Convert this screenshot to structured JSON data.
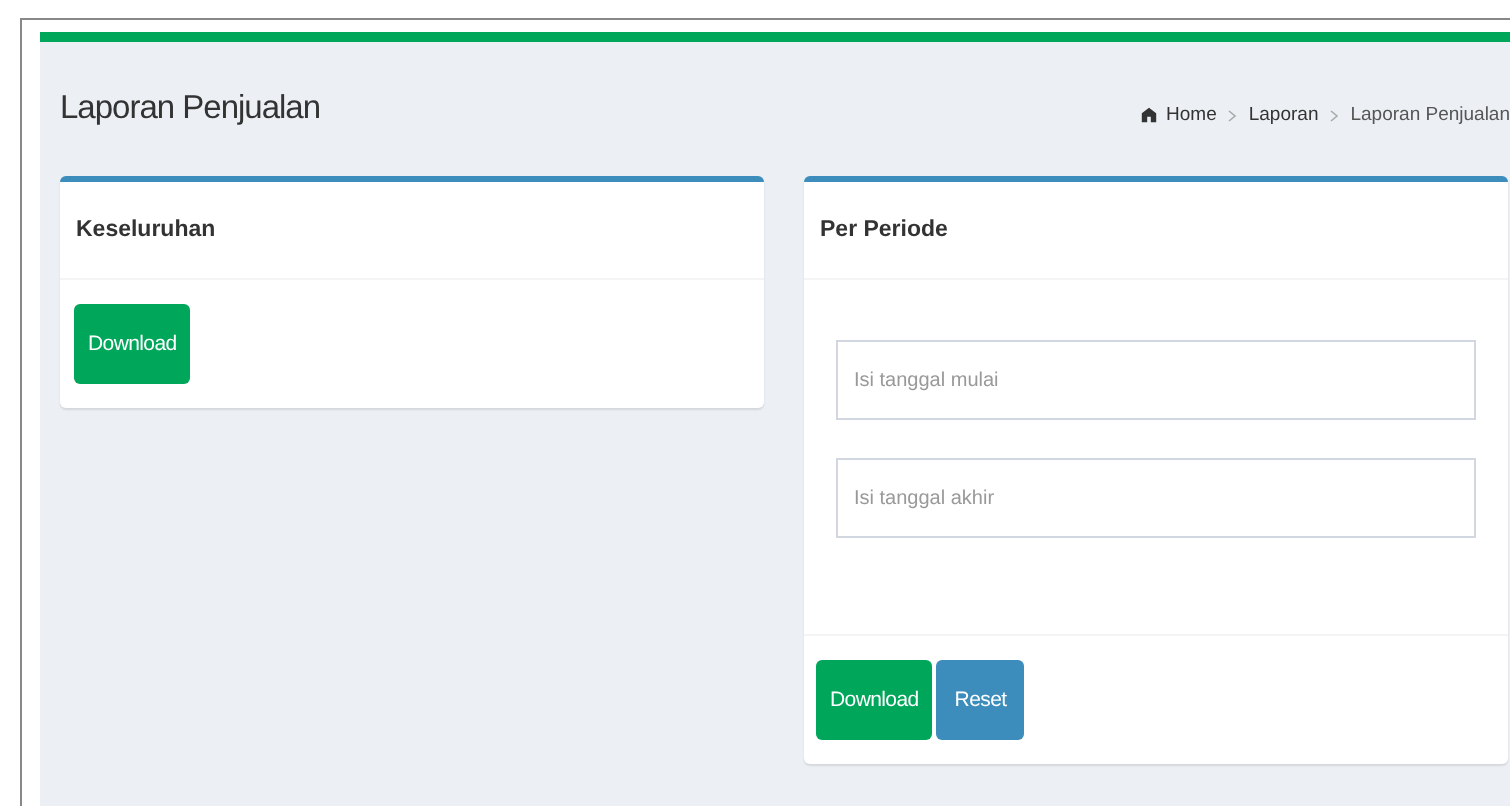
{
  "page": {
    "title": "Laporan Penjualan"
  },
  "breadcrumb": [
    {
      "label": "Home"
    },
    {
      "label": "Laporan"
    },
    {
      "label": "Laporan Penjualan"
    }
  ],
  "panels": [
    {
      "title": "Keseluruhan",
      "buttons": [
        {
          "label": "Download",
          "kind": "success"
        }
      ]
    },
    {
      "title": "Per Periode",
      "fields": [
        {
          "placeholder": "Isi tanggal mulai"
        },
        {
          "placeholder": "Isi tanggal akhir"
        }
      ],
      "footer_buttons": [
        {
          "label": "Download",
          "kind": "success"
        },
        {
          "label": "Reset",
          "kind": "primary"
        }
      ]
    }
  ]
}
